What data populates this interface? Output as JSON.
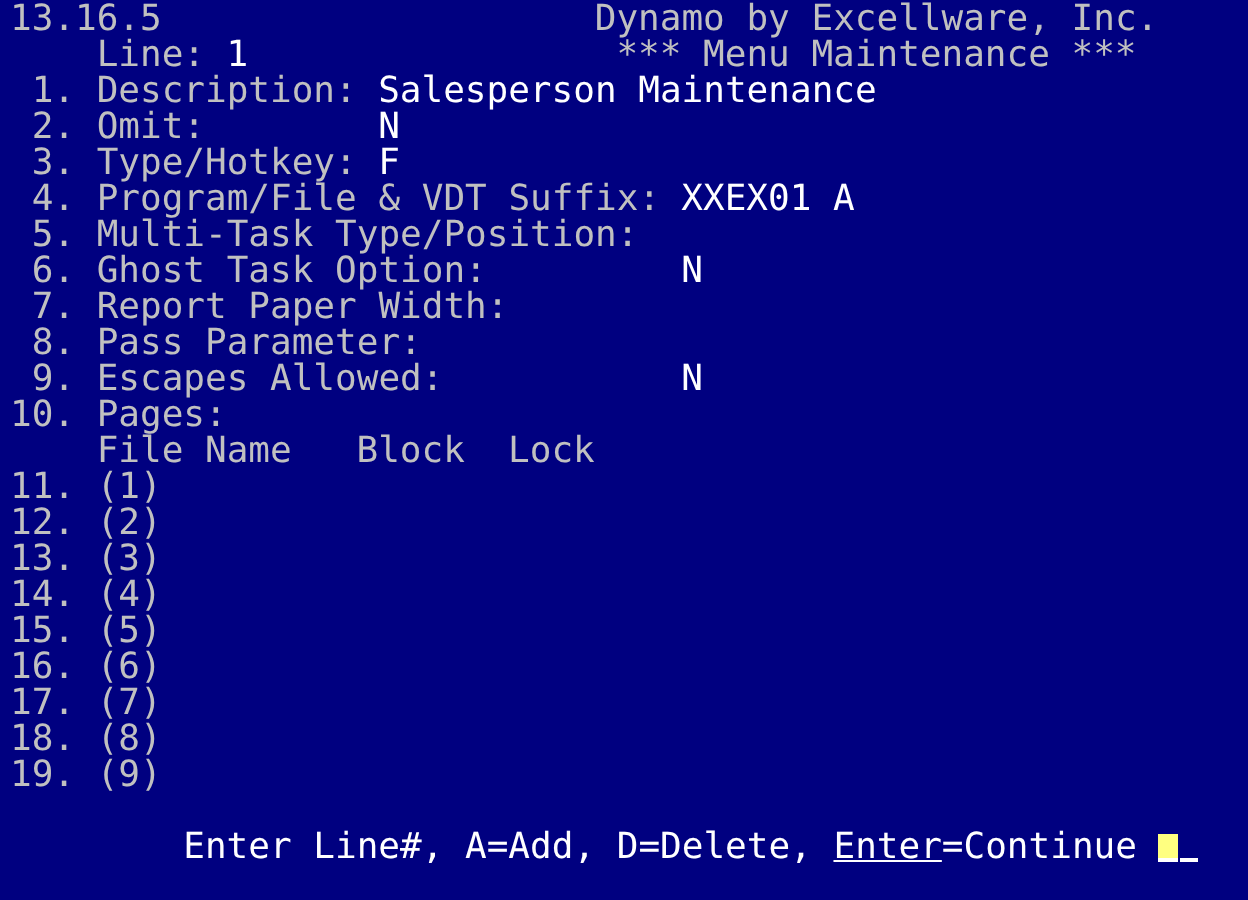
{
  "header": {
    "version": "13.16.5",
    "product": "Dynamo by Excellware, Inc.",
    "line_label": "Line:",
    "line_value": "1",
    "screen_title": "*** Menu Maintenance ***"
  },
  "fields": [
    {
      "number": "1.",
      "label": "Description:",
      "value": "Salesperson Maintenance"
    },
    {
      "number": "2.",
      "label": "Omit:",
      "value": "N"
    },
    {
      "number": "3.",
      "label": "Type/Hotkey:",
      "value": "F"
    },
    {
      "number": "4.",
      "label": "Program/File & VDT Suffix:",
      "value": "XXEX01 A"
    },
    {
      "number": "5.",
      "label": "Multi-Task Type/Position:"
    },
    {
      "number": "6.",
      "label": "Ghost Task Option:",
      "value": "N"
    },
    {
      "number": "7.",
      "label": "Report Paper Width:"
    },
    {
      "number": "8.",
      "label": "Pass Parameter:"
    },
    {
      "number": "9.",
      "label": "Escapes Allowed:",
      "value": "N"
    },
    {
      "number": "10.",
      "label": "Pages:"
    }
  ],
  "pages_columns": [
    "File Name",
    "Block",
    "Lock"
  ],
  "pages": [
    {
      "number": "11.",
      "slot": "(1)"
    },
    {
      "number": "12.",
      "slot": "(2)"
    },
    {
      "number": "13.",
      "slot": "(3)"
    },
    {
      "number": "14.",
      "slot": "(4)"
    },
    {
      "number": "15.",
      "slot": "(5)"
    },
    {
      "number": "16.",
      "slot": "(6)"
    },
    {
      "number": "17.",
      "slot": "(7)"
    },
    {
      "number": "18.",
      "slot": "(8)"
    },
    {
      "number": "19.",
      "slot": "(9)"
    }
  ],
  "prompt": [
    {
      "text": "Enter Line#, A=Add, D=Delete, ",
      "underlined": false
    },
    {
      "text": "Enter",
      "underlined": true
    },
    {
      "text": "=Continue",
      "underlined": false
    }
  ]
}
